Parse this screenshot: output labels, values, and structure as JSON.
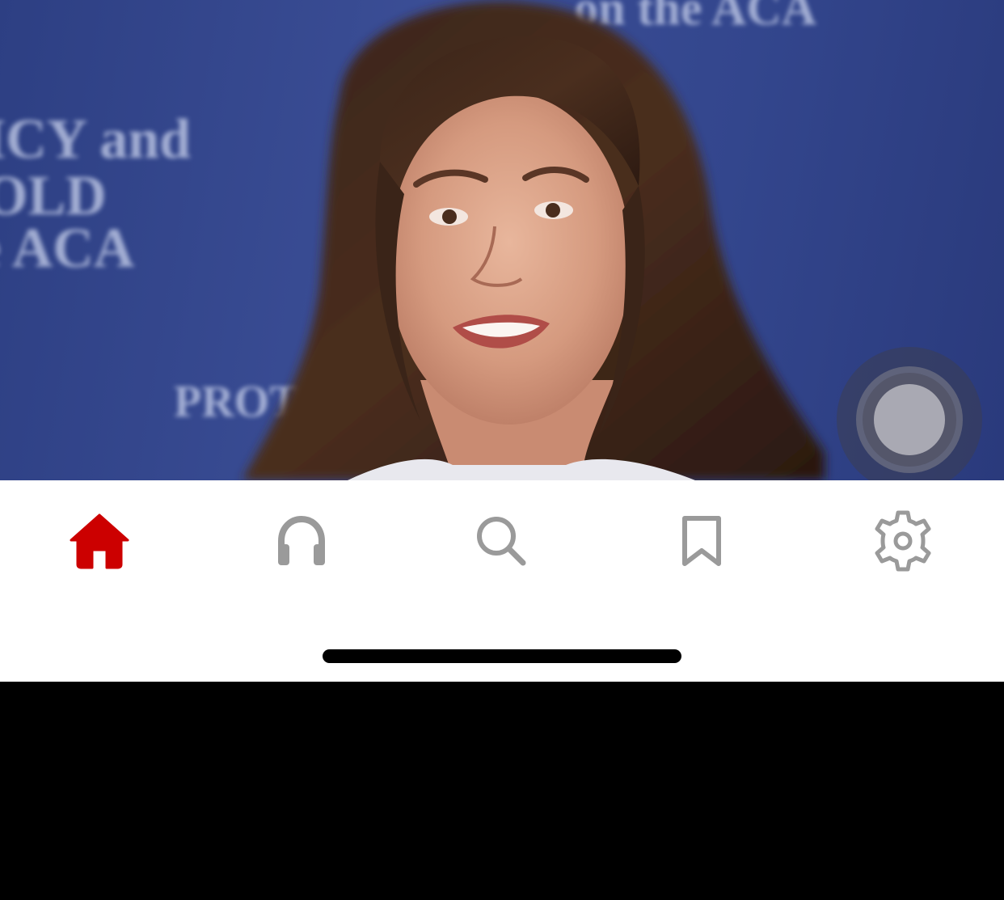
{
  "photo": {
    "backdrop_text": {
      "top_line": "on the ACA",
      "left_line_1": "ICY and",
      "left_line_2": "OLD",
      "left_line_3": "e ACA",
      "lower_fragment": "PROT"
    }
  },
  "tabbar": {
    "active_color": "#cc0000",
    "inactive_color": "#9a9a9a",
    "tabs": [
      {
        "icon": "home-icon",
        "active": true
      },
      {
        "icon": "headphones-icon",
        "active": false
      },
      {
        "icon": "search-icon",
        "active": false
      },
      {
        "icon": "bookmark-icon",
        "active": false
      },
      {
        "icon": "gear-icon",
        "active": false
      }
    ]
  }
}
